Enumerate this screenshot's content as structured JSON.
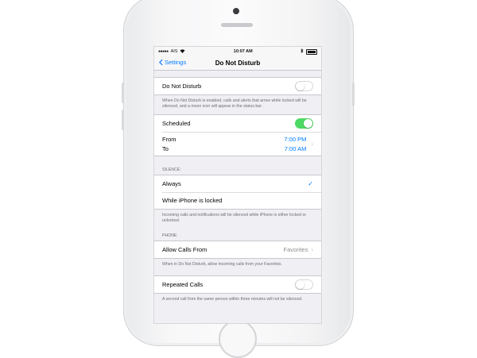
{
  "status_bar": {
    "carrier": "AIS",
    "time": "10:07 AM"
  },
  "nav": {
    "back_label": "Settings",
    "title": "Do Not Disturb"
  },
  "dnd": {
    "label": "Do Not Disturb",
    "enabled": false,
    "footer": "When Do Not Disturb is enabled, calls and alerts that arrive while locked will be silenced, and a moon icon will appear in the status bar."
  },
  "scheduled": {
    "label": "Scheduled",
    "enabled": true,
    "from_label": "From",
    "to_label": "To",
    "from_time": "7:00 PM",
    "to_time": "7:00 AM"
  },
  "silence": {
    "header": "SILENCE:",
    "options": [
      {
        "label": "Always",
        "selected": true
      },
      {
        "label": "While iPhone is locked",
        "selected": false
      }
    ],
    "footer": "Incoming calls and notifications will be silenced while iPhone is either locked or unlocked."
  },
  "phone": {
    "header": "PHONE",
    "allow_calls_label": "Allow Calls From",
    "allow_calls_value": "Favorites",
    "allow_calls_footer": "When in Do Not Disturb, allow incoming calls from your Favorites.",
    "repeated_calls_label": "Repeated Calls",
    "repeated_calls_enabled": false,
    "repeated_calls_footer": "A second call from the same person within three minutes will not be silenced."
  },
  "colors": {
    "accent": "#007aff",
    "toggle_on": "#4cd964",
    "group_background": "#efeff4"
  }
}
